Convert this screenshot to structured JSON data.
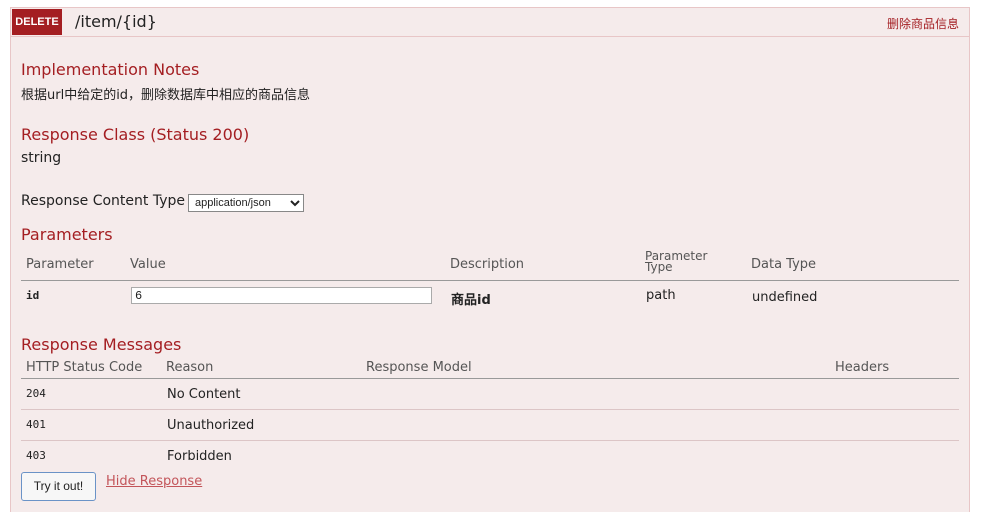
{
  "operation": {
    "method": "DELETE",
    "path": "/item/{id}",
    "summary": "删除商品信息"
  },
  "implementation_notes": {
    "heading": "Implementation Notes",
    "text": "根据url中给定的id，删除数据库中相应的商品信息"
  },
  "response_class": {
    "heading": "Response Class (Status 200)",
    "type": "string"
  },
  "response_content_type": {
    "label": "Response Content Type",
    "selected": "application/json"
  },
  "parameters": {
    "heading": "Parameters",
    "columns": [
      "Parameter",
      "Value",
      "Description",
      "Parameter Type",
      "Data Type"
    ],
    "column_parameter_type_line1": "Parameter",
    "column_parameter_type_line2": "Type",
    "rows": [
      {
        "name": "id",
        "value": "6",
        "description": "商品id",
        "param_type": "path",
        "data_type": "undefined"
      }
    ]
  },
  "response_messages": {
    "heading": "Response Messages",
    "columns": [
      "HTTP Status Code",
      "Reason",
      "Response Model",
      "Headers"
    ],
    "rows": [
      {
        "code": "204",
        "reason": "No Content"
      },
      {
        "code": "401",
        "reason": "Unauthorized"
      },
      {
        "code": "403",
        "reason": "Forbidden"
      }
    ]
  },
  "actions": {
    "try_label": "Try it out!",
    "hide_label": "Hide Response"
  },
  "colors": {
    "delete_accent": "#a41e22",
    "panel_bg": "#f5ebeb",
    "panel_border": "#e8c6c7"
  }
}
